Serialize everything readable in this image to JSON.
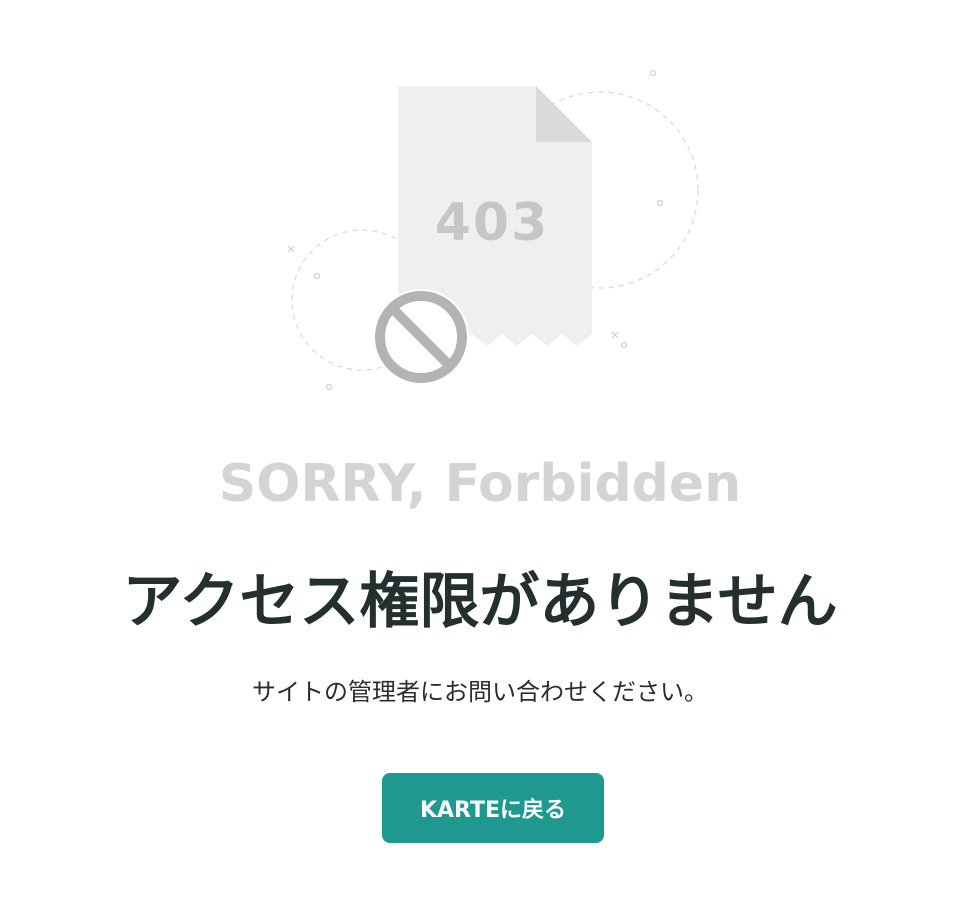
{
  "illustration": {
    "error_code": "403",
    "icons": [
      "document-icon",
      "forbidden-icon"
    ]
  },
  "message": {
    "sorry_text": "SORRY, Forbidden",
    "heading": "アクセス権限がありません",
    "subtext": "サイトの管理者にお問い合わせください。"
  },
  "actions": {
    "back_label": "KARTEに戻る"
  },
  "colors": {
    "accent": "#1f9990",
    "heading": "#23302f",
    "muted": "#d4d4d4",
    "paper": "#efefef",
    "icon": "#b3b3b3"
  }
}
